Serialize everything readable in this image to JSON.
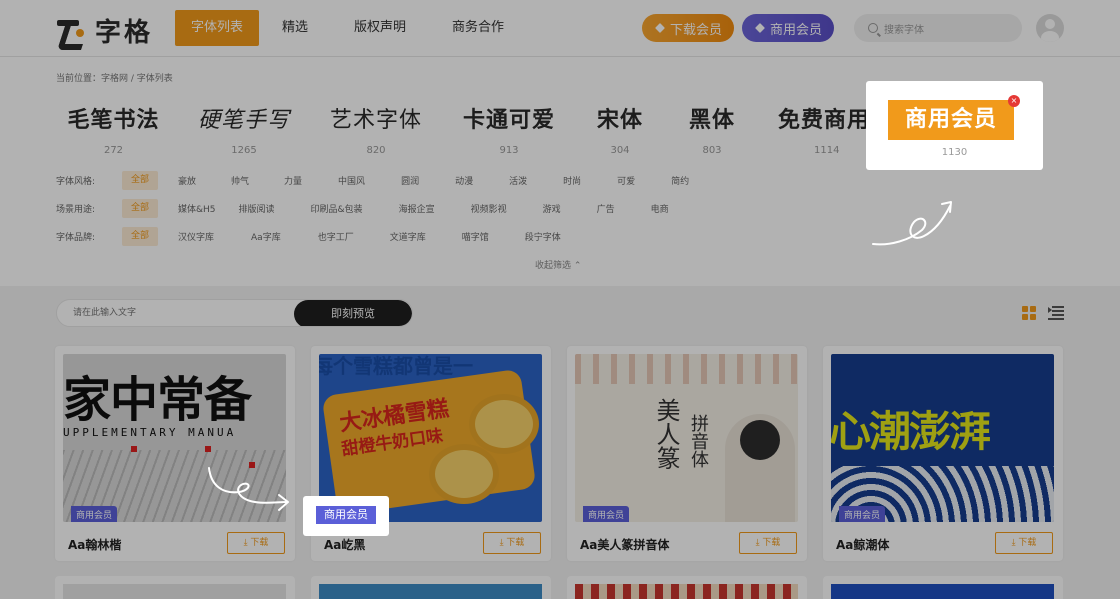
{
  "header": {
    "logo_text": "字格",
    "nav": [
      {
        "label": "字体列表",
        "active": true
      },
      {
        "label": "精选"
      },
      {
        "label": "版权声明"
      },
      {
        "label": "商务合作"
      }
    ],
    "download_vip": "下载会员",
    "commercial_vip": "商用会员",
    "search_placeholder": "搜索字体"
  },
  "breadcrumb": "当前位置：字格网 / 字体列表",
  "categories": [
    {
      "name": "毛笔书法",
      "count": "272"
    },
    {
      "name": "硬笔手写",
      "count": "1265"
    },
    {
      "name": "艺术字体",
      "count": "820"
    },
    {
      "name": "卡通可爱",
      "count": "913"
    },
    {
      "name": "宋体",
      "count": "304"
    },
    {
      "name": "黑体",
      "count": "803"
    },
    {
      "name": "免费商用",
      "count": "1114"
    }
  ],
  "popup": {
    "label": "商用会员",
    "count": "1130",
    "close": "×"
  },
  "filters": {
    "style": {
      "label": "字体风格:",
      "options": [
        "全部",
        "豪放",
        "帅气",
        "力量",
        "中国风",
        "圆润",
        "动漫",
        "活泼",
        "时尚",
        "可爱",
        "简约"
      ]
    },
    "scene": {
      "label": "场景用途:",
      "options": [
        "全部",
        "媒体&H5",
        "排版阅读",
        "印刷品&包装",
        "海报企宣",
        "视频影视",
        "游戏",
        "广告",
        "电商"
      ]
    },
    "brand": {
      "label": "字体品牌:",
      "options": [
        "全部",
        "汉仪字库",
        "Aa字库",
        "也字工厂",
        "文道字库",
        "喵字馆",
        "段宁字体"
      ]
    },
    "collapse": "收起筛选 ⌃"
  },
  "preview": {
    "placeholder": "请在此输入文字",
    "button": "即刻预览"
  },
  "cards": [
    {
      "title": "Aa翰林楷",
      "badge": "商用会员",
      "download": "⤓ 下载",
      "img_text": "家中常备",
      "img_sub": "UPPLEMENTARY MANUA"
    },
    {
      "title": "Aa屹黑",
      "badge": "商用会员",
      "download": "⤓ 下载",
      "img_text": "大冰橘雪糕",
      "img_sub": "甜橙牛奶口味"
    },
    {
      "title": "Aa美人篆拼音体",
      "badge": "商用会员",
      "download": "⤓ 下载",
      "img_text": "美人篆",
      "img_sub": "拼音体"
    },
    {
      "title": "Aa鲸潮体",
      "badge": "商用会员",
      "download": "⤓ 下载",
      "img_text": "心潮澎湃",
      "img_sub": ""
    }
  ],
  "tip_label": "商用会员",
  "colors": {
    "accent": "#f19a1b",
    "vip_purple": "#5b5fd8",
    "overlay": "rgba(0,0,0,0.30)"
  }
}
